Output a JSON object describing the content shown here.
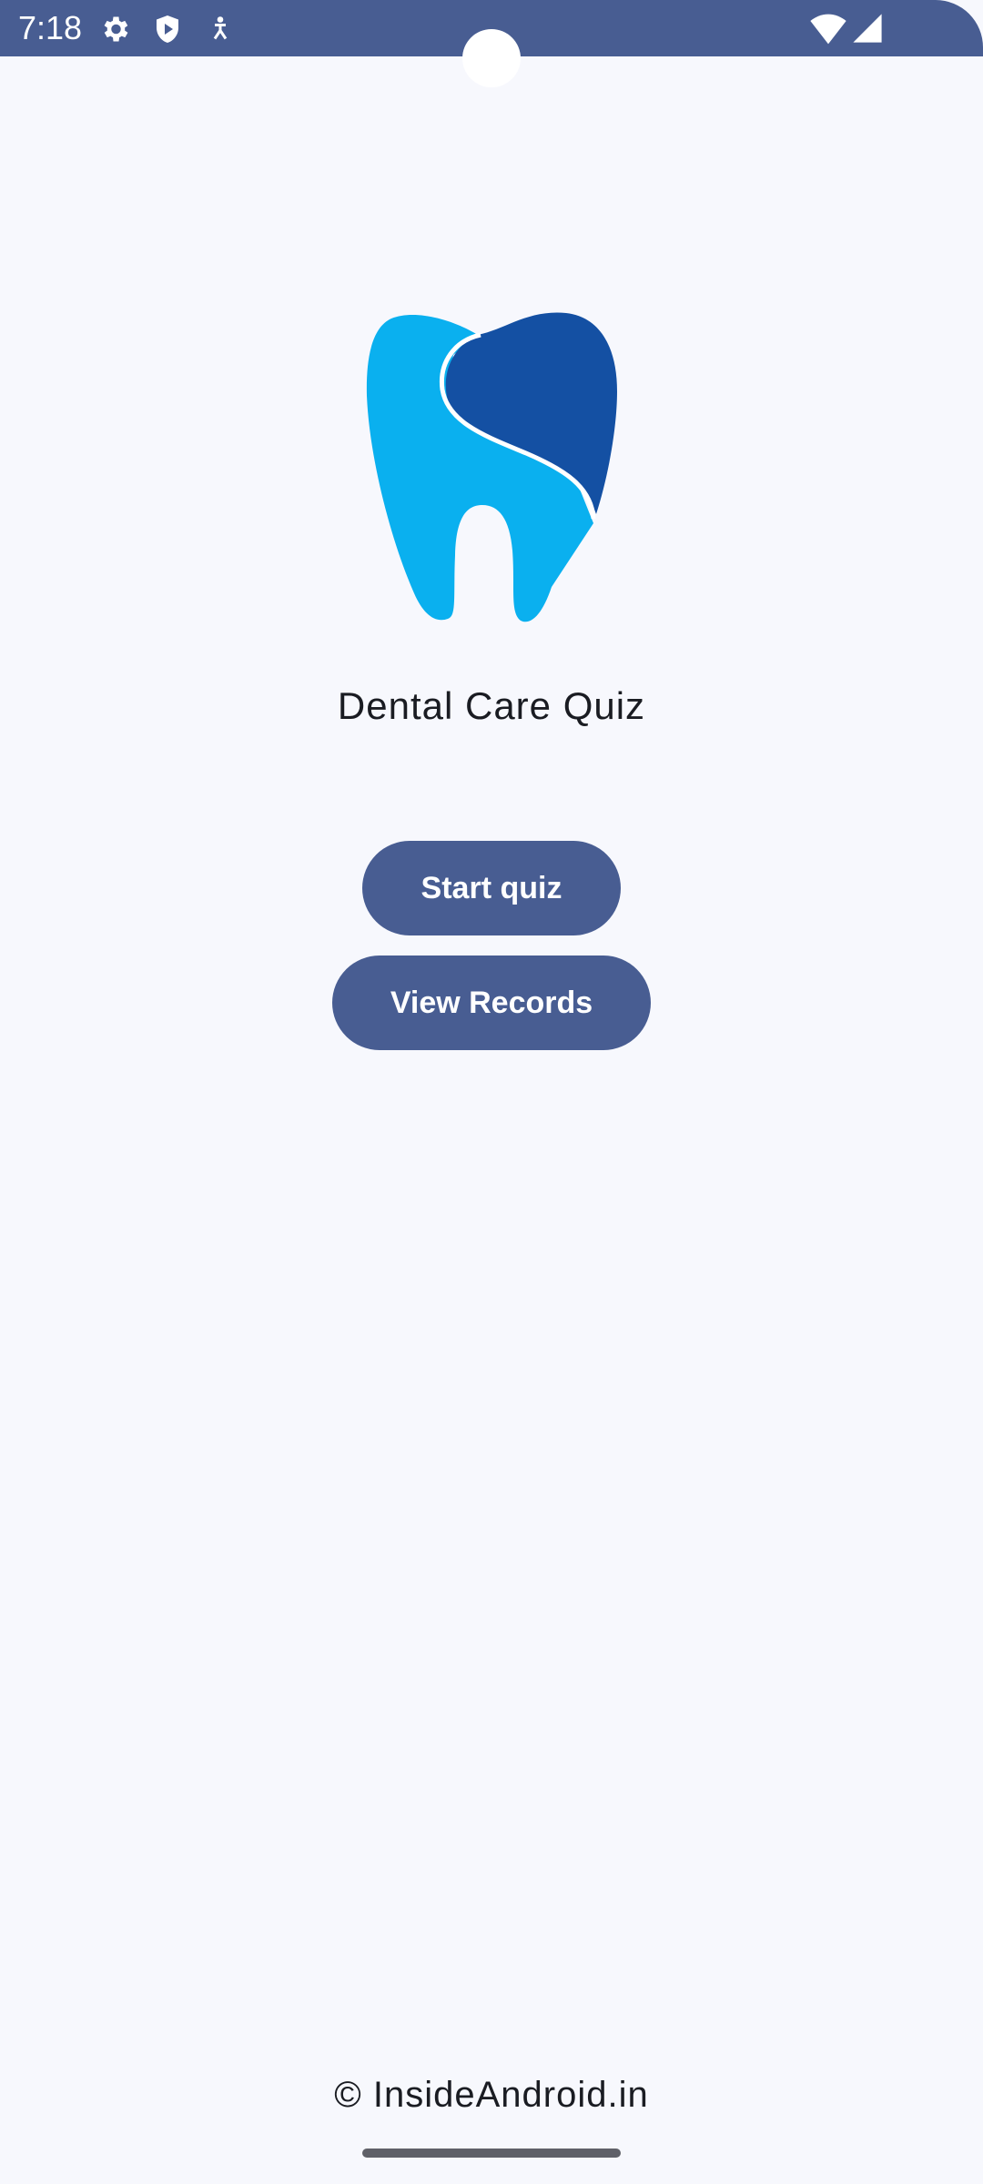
{
  "status_bar": {
    "time": "7:18",
    "left_icons": [
      "gear-icon",
      "shield-play-icon",
      "accessibility-icon"
    ],
    "right_icons": [
      "wifi-icon",
      "cellular-signal-icon"
    ],
    "background_color": "#485d92"
  },
  "app": {
    "logo_icon": "tooth-icon",
    "title": "Dental Care Quiz",
    "colors": {
      "tooth_light": "#0ab0ef",
      "tooth_dark": "#1450a3",
      "button": "#485d92"
    }
  },
  "actions": {
    "start_quiz_label": "Start quiz",
    "view_records_label": "View Records"
  },
  "footer": {
    "copyright": "© InsideAndroid.in"
  }
}
